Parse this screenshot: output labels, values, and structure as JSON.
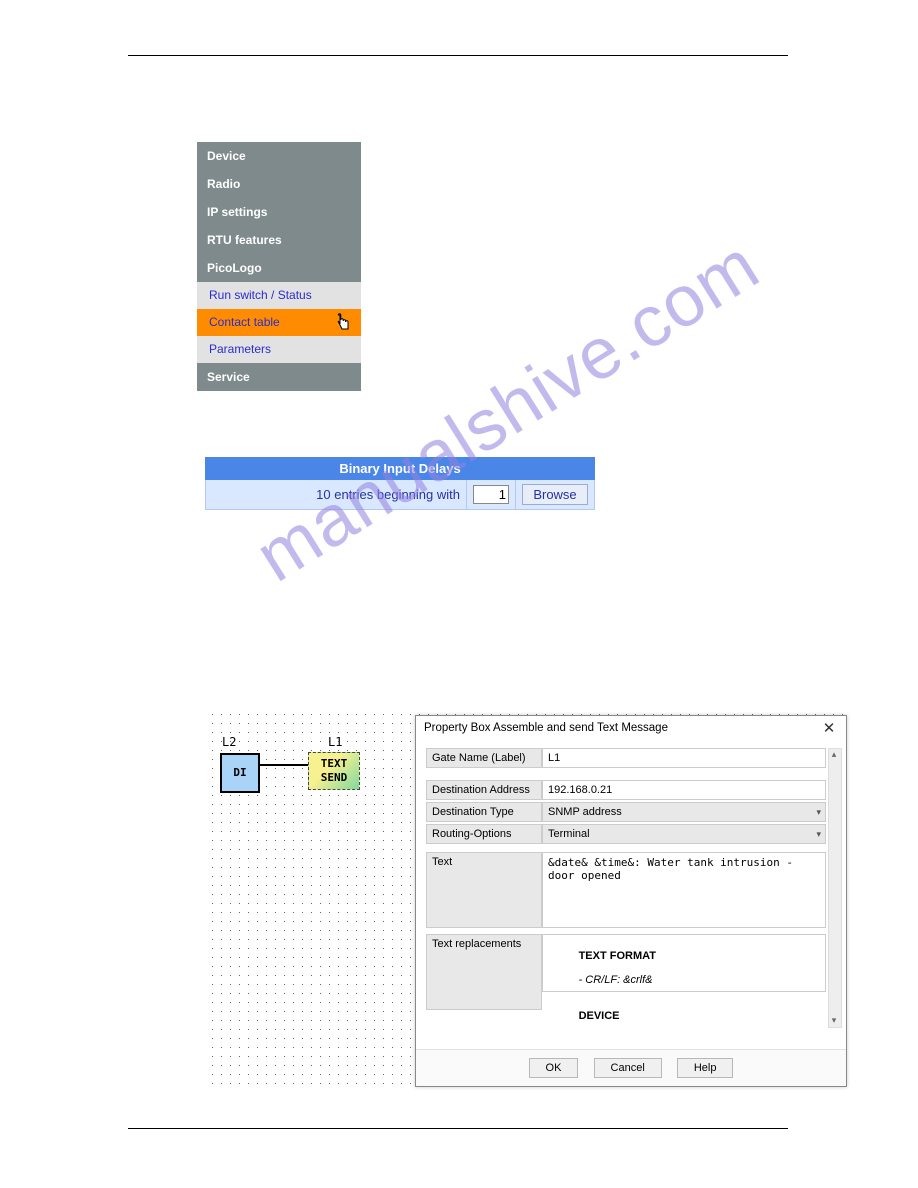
{
  "watermark": "manualshive.com",
  "nav": {
    "device": "Device",
    "radio": "Radio",
    "ip": "IP settings",
    "rtu": "RTU features",
    "picologo": "PicoLogo",
    "run_status": "Run switch / Status",
    "contact_table": "Contact table",
    "parameters": "Parameters",
    "service": "Service"
  },
  "bid": {
    "title": "Binary Input Delays",
    "lbl": "10 entries beginning with",
    "value": "1",
    "browse": "Browse"
  },
  "diagram": {
    "l2": "L2",
    "di": "DI",
    "l1": "L1",
    "text_send": "TEXT\nSEND"
  },
  "dialog": {
    "title": "Property Box Assemble and send Text Message",
    "gate_name_lbl": "Gate Name (Label)",
    "gate_name_val": "L1",
    "dest_addr_lbl": "Destination Address",
    "dest_addr_val": "192.168.0.21",
    "dest_type_lbl": "Destination Type",
    "dest_type_val": "SNMP address",
    "routing_lbl": "Routing-Options",
    "routing_val": "Terminal",
    "text_lbl": "Text",
    "text_val": "&date& &time&: Water tank intrusion - door opened",
    "repl_lbl": "Text replacements",
    "repl_heading1": "TEXT FORMAT",
    "repl_line1": "- CR/LF: &crlf&",
    "repl_heading2": "DEVICE",
    "ok": "OK",
    "cancel": "Cancel",
    "help": "Help"
  }
}
